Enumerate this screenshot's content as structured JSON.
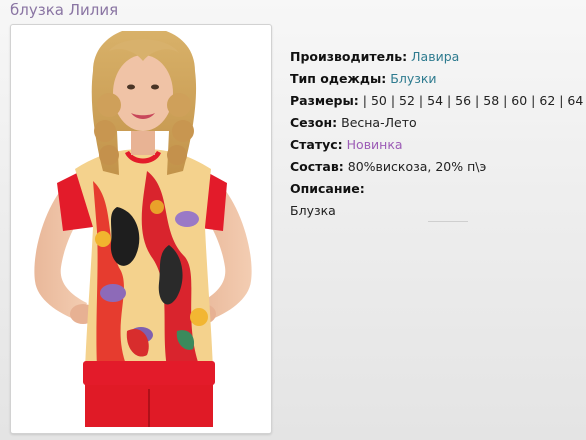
{
  "product": {
    "title": "блузка Лилия"
  },
  "details": {
    "manufacturer": {
      "label": "Производитель:",
      "value": "Лавира"
    },
    "clothing_type": {
      "label": "Тип одежды:",
      "value": "Блузки"
    },
    "sizes": {
      "label": "Размеры:",
      "value": "| 50 | 52 | 54 | 56 | 58 | 60 | 62 | 64 |"
    },
    "season": {
      "label": "Сезон:",
      "value": "Весна-Лето"
    },
    "status": {
      "label": "Статус:",
      "value": "Новинка"
    },
    "composition": {
      "label": "Состав:",
      "value": "80%вискоза, 20% п\\э"
    },
    "description": {
      "label": "Описание:",
      "value": "Блузка"
    }
  },
  "colors": {
    "title": "#8a75a3",
    "link_blue": "#2e7b8f",
    "link_purple": "#9c5cb6",
    "garment_red": "#e31b2a"
  }
}
